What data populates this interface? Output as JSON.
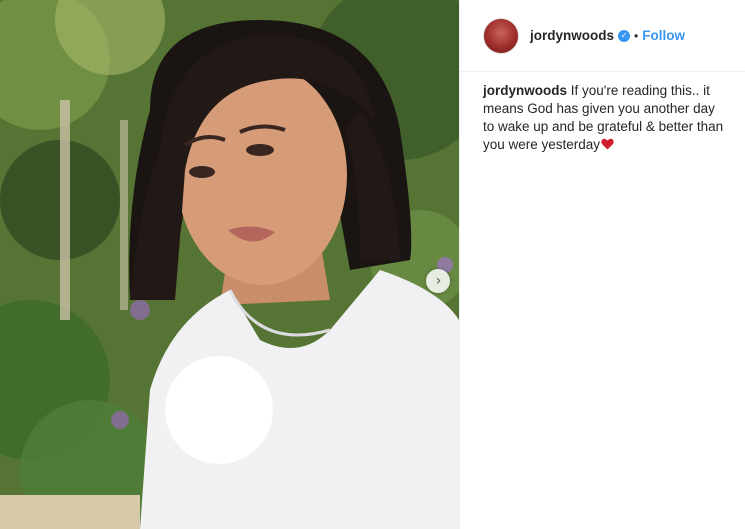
{
  "post": {
    "username": "jordynwoods",
    "dot": "•",
    "follow_label": "Follow",
    "caption_text": "If you're reading this.. it means God has given you another day to wake up and be grateful & better than you were yesterday",
    "caption_emoji": "red-heart-icon"
  },
  "media": {
    "next_arrow_glyph": "›"
  },
  "colors": {
    "accent": "#3897f0",
    "text": "#262626",
    "border": "#efefef"
  }
}
